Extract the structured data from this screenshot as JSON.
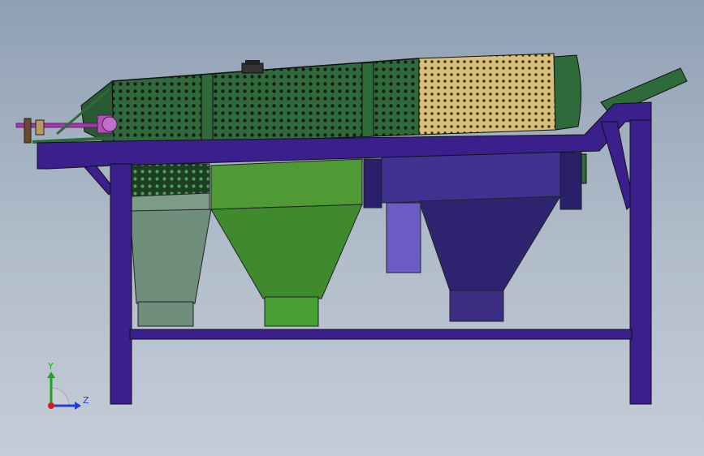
{
  "viewport": {
    "background_top": "#8fa0b4",
    "background_bottom": "#c4ccd7"
  },
  "machine": {
    "frame_color": "#3b1f8c",
    "drum_color": "#2f6a3a",
    "fine_screen_color": "#d8c07a",
    "hopper_colors": {
      "hopper_1": "#6f8f7c",
      "hopper_2": "#3f8a2c",
      "hopper_3": "#3a2d82"
    },
    "chute_color": "#6b5cc4",
    "shaft_color": "#a03aa6"
  },
  "triad": {
    "y_label": "Y",
    "z_label": "Z",
    "y_color": "#1fa31f",
    "z_color": "#1f3fd6",
    "x_color": "#d01f1f"
  }
}
